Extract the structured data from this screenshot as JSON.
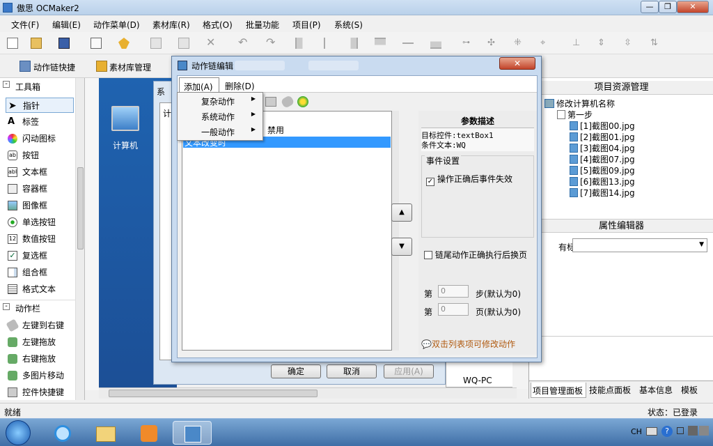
{
  "window": {
    "title": "傲思 OCMaker2",
    "min": "—",
    "max": "❐",
    "close": "✕"
  },
  "menu": [
    "文件(F)",
    "编辑(E)",
    "动作菜单(D)",
    "素材库(R)",
    "格式(O)",
    "批量功能",
    "项目(P)",
    "系统(S)"
  ],
  "toolbar2": {
    "action_chain_shortcut": "动作链快捷",
    "material_library": "素材库管理"
  },
  "toolbox": {
    "header": "工具箱",
    "items": [
      "指针",
      "标签",
      "闪动图标",
      "按钮",
      "文本框",
      "容器框",
      "图像框",
      "单选按钮",
      "数值按钮",
      "复选框",
      "组合框",
      "格式文本"
    ],
    "section2": "动作栏",
    "actions": [
      "左键到右键",
      "左键拖放",
      "右键拖放",
      "多图片移动",
      "控件快捷键"
    ]
  },
  "desktop": {
    "computer_label": "计算机"
  },
  "sys_dialog": {
    "title_partial": "系",
    "tab_partial": "计",
    "ok": "确定",
    "cancel": "取消",
    "apply": "应用(A)",
    "pc_name": "WQ-PC"
  },
  "dialog": {
    "title": "动作链编辑",
    "menu_add": "添加(A)",
    "menu_delete": "删除(D)",
    "list_item1": "禁用",
    "list_item2": "文本改变时",
    "context_menu": [
      "复杂动作",
      "系统动作",
      "一般动作"
    ],
    "param_title": "参数描述",
    "param_line1": "目标控件:textBox1",
    "param_line2": "条件文本:WQ",
    "event_title": "事件设置",
    "event_check": "操作正确后事件失效",
    "chain_check": "链尾动作正确执行后换页",
    "step_prefix": "第",
    "step_value": "0",
    "step_suffix": "步(默认为0)",
    "page_prefix": "第",
    "page_value": "0",
    "page_suffix": "页(默认为0)",
    "hint": "双击列表项可修改动作",
    "close": "✕"
  },
  "project_panel": {
    "title": "项目资源管理",
    "root": "修改计算机名称",
    "step": "第一步",
    "files": [
      "[1]截图00.jpg",
      "[2]截图01.jpg",
      "[3]截图04.jpg",
      "[4]截图07.jpg",
      "[5]截图09.jpg",
      "[6]截图13.jpg",
      "[7]截图14.jpg"
    ]
  },
  "property_panel": {
    "title": "属性编辑器",
    "tag_label": "有标签"
  },
  "bottom_tabs": [
    "项目管理面板",
    "技能点面板",
    "基本信息",
    "模板"
  ],
  "status": {
    "left": "就绪",
    "right": "状态：已登录"
  },
  "tray": {
    "lang": "CH"
  }
}
